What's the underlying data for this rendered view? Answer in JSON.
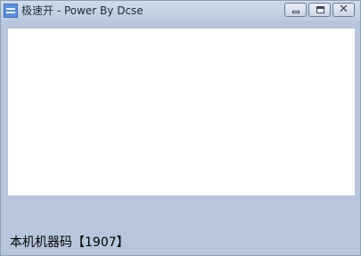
{
  "window": {
    "title": "极速开 - Power By Dcse"
  },
  "titlebar": {
    "icon": "app-icon",
    "buttons": {
      "minimize": "minimize-icon",
      "maximize": "maximize-icon",
      "close": "close-icon"
    }
  },
  "status": {
    "machine_code": "本机机器码【1907】"
  },
  "colors": {
    "window_background": "#b7c6dc",
    "panel_background": "#ffffff"
  }
}
